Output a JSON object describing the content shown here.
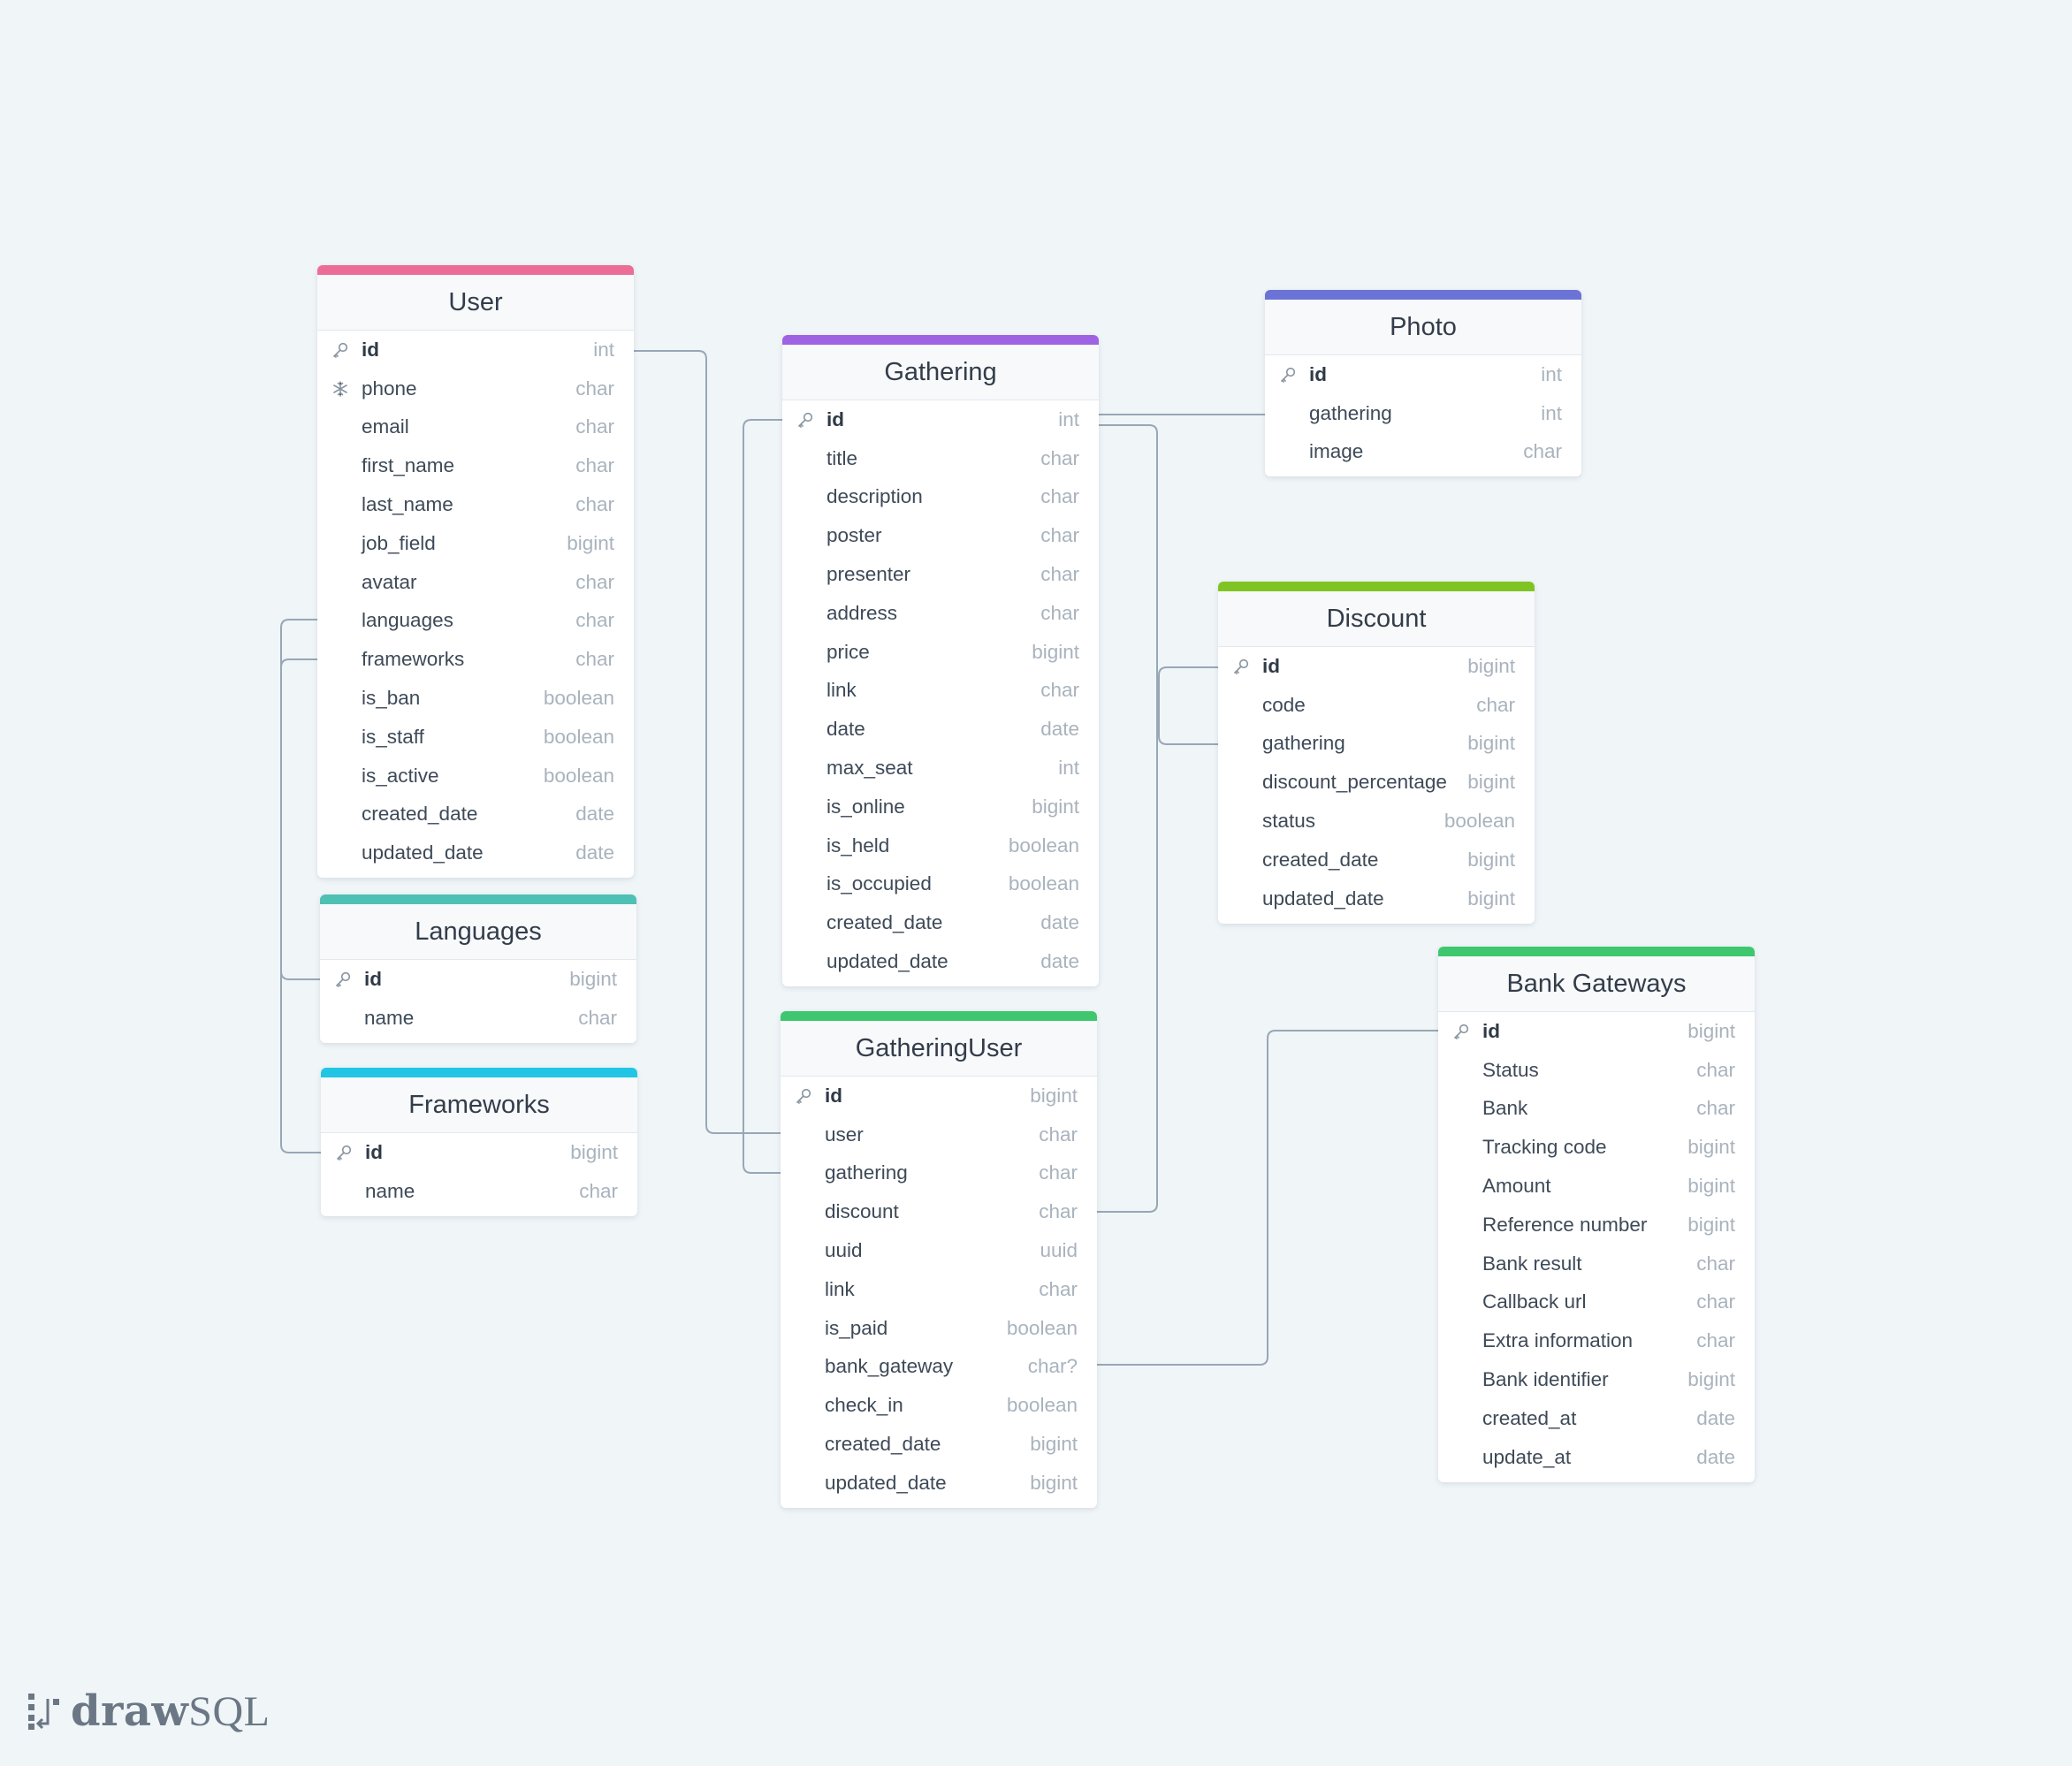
{
  "colors": {
    "user": "#ec6e97",
    "gathering": "#9f62e3",
    "photo": "#6c73d6",
    "discount": "#80c423",
    "languages": "#4ec0b4",
    "frameworks": "#22c6e4",
    "gathering_user": "#3ec76f",
    "bank_gateways": "#3ec76f",
    "connector": "#98a7b6"
  },
  "tables": {
    "user": {
      "title": "User",
      "fields": [
        {
          "name": "id",
          "type": "int",
          "icon": "key-icon"
        },
        {
          "name": "phone",
          "type": "char",
          "icon": "snowflake-icon"
        },
        {
          "name": "email",
          "type": "char"
        },
        {
          "name": "first_name",
          "type": "char"
        },
        {
          "name": "last_name",
          "type": "char"
        },
        {
          "name": "job_field",
          "type": "bigint"
        },
        {
          "name": "avatar",
          "type": "char"
        },
        {
          "name": "languages",
          "type": "char"
        },
        {
          "name": "frameworks",
          "type": "char"
        },
        {
          "name": "is_ban",
          "type": "boolean"
        },
        {
          "name": "is_staff",
          "type": "boolean"
        },
        {
          "name": "is_active",
          "type": "boolean"
        },
        {
          "name": "created_date",
          "type": "date"
        },
        {
          "name": "updated_date",
          "type": "date"
        }
      ]
    },
    "languages": {
      "title": "Languages",
      "fields": [
        {
          "name": "id",
          "type": "bigint",
          "icon": "key-icon"
        },
        {
          "name": "name",
          "type": "char"
        }
      ]
    },
    "frameworks": {
      "title": "Frameworks",
      "fields": [
        {
          "name": "id",
          "type": "bigint",
          "icon": "key-icon"
        },
        {
          "name": "name",
          "type": "char"
        }
      ]
    },
    "gathering": {
      "title": "Gathering",
      "fields": [
        {
          "name": "id",
          "type": "int",
          "icon": "key-icon"
        },
        {
          "name": "title",
          "type": "char"
        },
        {
          "name": "description",
          "type": "char"
        },
        {
          "name": "poster",
          "type": "char"
        },
        {
          "name": "presenter",
          "type": "char"
        },
        {
          "name": "address",
          "type": "char"
        },
        {
          "name": "price",
          "type": "bigint"
        },
        {
          "name": "link",
          "type": "char"
        },
        {
          "name": "date",
          "type": "date"
        },
        {
          "name": "max_seat",
          "type": "int"
        },
        {
          "name": "is_online",
          "type": "bigint"
        },
        {
          "name": "is_held",
          "type": "boolean"
        },
        {
          "name": "is_occupied",
          "type": "boolean"
        },
        {
          "name": "created_date",
          "type": "date"
        },
        {
          "name": "updated_date",
          "type": "date"
        }
      ]
    },
    "gathering_user": {
      "title": "GatheringUser",
      "fields": [
        {
          "name": "id",
          "type": "bigint",
          "icon": "key-icon"
        },
        {
          "name": "user",
          "type": "char"
        },
        {
          "name": "gathering",
          "type": "char"
        },
        {
          "name": "discount",
          "type": "char"
        },
        {
          "name": "uuid",
          "type": "uuid"
        },
        {
          "name": "link",
          "type": "char"
        },
        {
          "name": "is_paid",
          "type": "boolean"
        },
        {
          "name": "bank_gateway",
          "type": "char?"
        },
        {
          "name": "check_in",
          "type": "boolean"
        },
        {
          "name": "created_date",
          "type": "bigint"
        },
        {
          "name": "updated_date",
          "type": "bigint"
        }
      ]
    },
    "photo": {
      "title": "Photo",
      "fields": [
        {
          "name": "id",
          "type": "int",
          "icon": "key-icon"
        },
        {
          "name": "gathering",
          "type": "int"
        },
        {
          "name": "image",
          "type": "char"
        }
      ]
    },
    "discount": {
      "title": "Discount",
      "fields": [
        {
          "name": "id",
          "type": "bigint",
          "icon": "key-icon"
        },
        {
          "name": "code",
          "type": "char"
        },
        {
          "name": "gathering",
          "type": "bigint"
        },
        {
          "name": "discount_percentage",
          "type": "bigint"
        },
        {
          "name": "status",
          "type": "boolean"
        },
        {
          "name": "created_date",
          "type": "bigint"
        },
        {
          "name": "updated_date",
          "type": "bigint"
        }
      ]
    },
    "bank_gateways": {
      "title": "Bank Gateways",
      "fields": [
        {
          "name": "id",
          "type": "bigint",
          "icon": "key-icon"
        },
        {
          "name": "Status",
          "type": "char"
        },
        {
          "name": "Bank",
          "type": "char"
        },
        {
          "name": "Tracking code",
          "type": "bigint"
        },
        {
          "name": "Amount",
          "type": "bigint"
        },
        {
          "name": "Reference number",
          "type": "bigint"
        },
        {
          "name": "Bank result",
          "type": "char"
        },
        {
          "name": "Callback url",
          "type": "char"
        },
        {
          "name": "Extra information",
          "type": "char"
        },
        {
          "name": "Bank identifier",
          "type": "bigint"
        },
        {
          "name": "created_at",
          "type": "date"
        },
        {
          "name": "update_at",
          "type": "date"
        }
      ]
    }
  },
  "relations": [
    {
      "from": "user.id",
      "to": "gathering_user.user"
    },
    {
      "from": "user.languages",
      "to": "languages.id"
    },
    {
      "from": "user.frameworks",
      "to": "frameworks.id"
    },
    {
      "from": "gathering.id",
      "to": "gathering_user.gathering"
    },
    {
      "from": "gathering.id",
      "to": "photo.gathering"
    },
    {
      "from": "gathering.id",
      "to": "discount.gathering"
    },
    {
      "from": "discount.id",
      "to": "gathering_user.discount"
    },
    {
      "from": "bank_gateways.id",
      "to": "gathering_user.bank_gateway"
    }
  ],
  "brand": {
    "bold": "draw",
    "light": "SQL",
    "icon": "drawsql-logo-icon"
  }
}
